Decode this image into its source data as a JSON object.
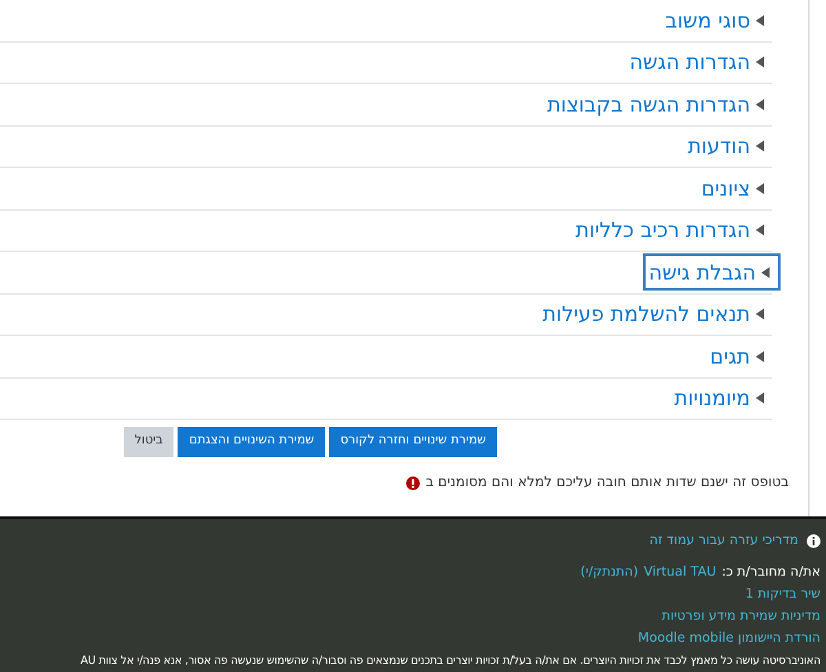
{
  "sections": [
    {
      "label": "סוגי משוב",
      "expanded": false,
      "focused": false
    },
    {
      "label": "הגדרות הגשה",
      "expanded": false,
      "focused": false
    },
    {
      "label": "הגדרות הגשה בקבוצות",
      "expanded": false,
      "focused": false
    },
    {
      "label": "הודעות",
      "expanded": false,
      "focused": false
    },
    {
      "label": "ציונים",
      "expanded": false,
      "focused": false
    },
    {
      "label": "הגדרות רכיב כלליות",
      "expanded": false,
      "focused": false
    },
    {
      "label": "הגבלת גישה",
      "expanded": false,
      "focused": true
    },
    {
      "label": "תנאים להשלמת פעילות",
      "expanded": false,
      "focused": false
    },
    {
      "label": "תגים",
      "expanded": false,
      "focused": false
    },
    {
      "label": "מיומנויות",
      "expanded": false,
      "focused": false
    }
  ],
  "buttons": [
    {
      "label": "שמירת שינויים וחזרה לקורס",
      "kind": "primary"
    },
    {
      "label": "שמירת השינויים והצגתם",
      "kind": "primary"
    },
    {
      "label": "ביטול",
      "kind": "secondary"
    }
  ],
  "required_note": "בטופס זה ישנם שדות אותם חובה עליכם למלא והם מסומנים ב",
  "footer": {
    "help_link": "מדריכי עזרה עבור עמוד זה",
    "logged_in_prefix": "את/ה מחובר/ת כ:",
    "user_link": "Virtual TAU",
    "logout_link": "(התנתק/י)",
    "links": [
      "שיר בדיקות 1",
      "מדיניות שמירת מידע ופרטיות",
      "הורדת היישומון Moodle mobile"
    ],
    "notice": "האוניברסיטה עושה כל מאמץ לכבד את זכויות היוצרים. אם את/ה בעל/ת זכויות יוצרים בתכנים שנמצאים פה וסבור/ה שהשימוש שנעשה פה אסור, אנא פנה/י אל צוות AU"
  }
}
